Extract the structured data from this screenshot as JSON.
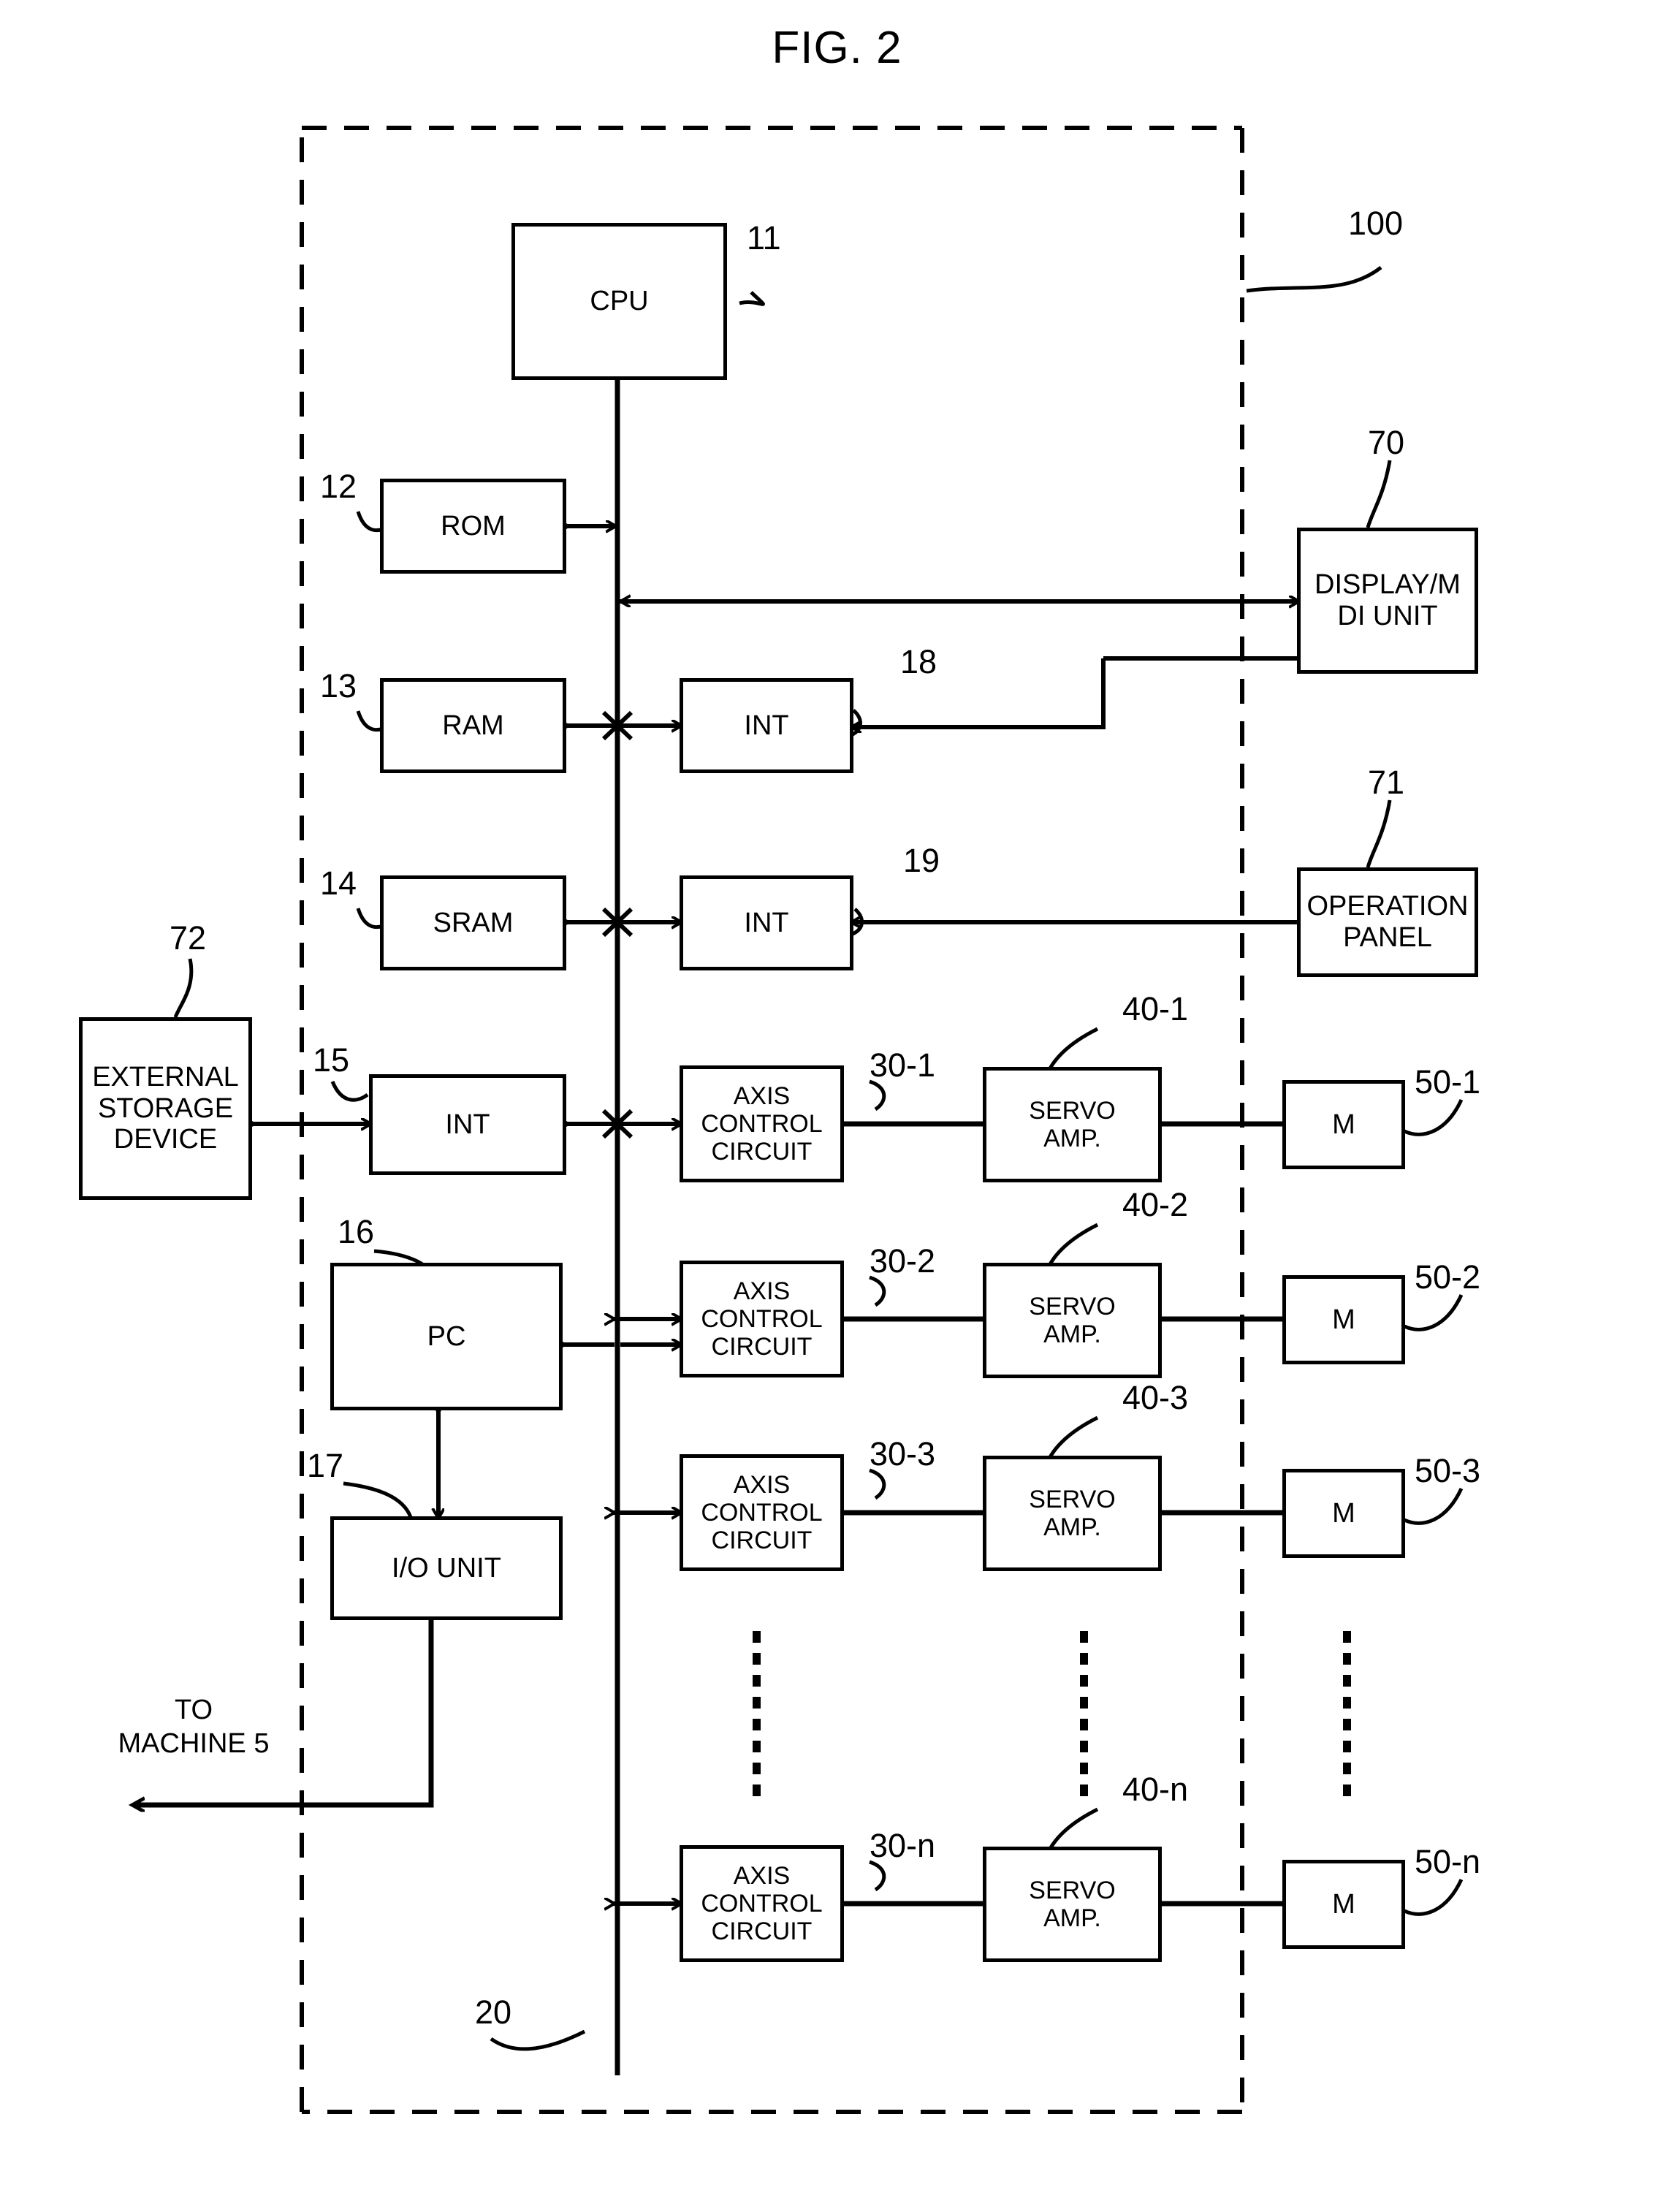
{
  "figure": {
    "title": "FIG. 2",
    "system_ref": "100",
    "bus_ref": "20"
  },
  "blocks": {
    "cpu": {
      "label": "CPU",
      "ref": "11"
    },
    "rom": {
      "label": "ROM",
      "ref": "12"
    },
    "ram": {
      "label": "RAM",
      "ref": "13"
    },
    "sram": {
      "label": "SRAM",
      "ref": "14"
    },
    "int15": {
      "label": "INT",
      "ref": "15"
    },
    "pc": {
      "label": "PC",
      "ref": "16"
    },
    "io": {
      "label": "I/O UNIT",
      "ref": "17"
    },
    "int18": {
      "label": "INT",
      "ref": "18"
    },
    "int19": {
      "label": "INT",
      "ref": "19"
    },
    "display": {
      "label": "DISPLAY/M\nDI UNIT",
      "ref": "70"
    },
    "operation": {
      "label": "OPERATION\nPANEL",
      "ref": "71"
    },
    "external": {
      "label": "EXTERNAL\nSTORAGE\nDEVICE",
      "ref": "72"
    }
  },
  "axes": [
    {
      "axis_label": "AXIS\nCONTROL\nCIRCUIT",
      "axis_ref": "30-1",
      "amp_label": "SERVO\nAMP.",
      "amp_ref": "40-1",
      "motor_label": "M",
      "motor_ref": "50-1"
    },
    {
      "axis_label": "AXIS\nCONTROL\nCIRCUIT",
      "axis_ref": "30-2",
      "amp_label": "SERVO\nAMP.",
      "amp_ref": "40-2",
      "motor_label": "M",
      "motor_ref": "50-2"
    },
    {
      "axis_label": "AXIS\nCONTROL\nCIRCUIT",
      "axis_ref": "30-3",
      "amp_label": "SERVO\nAMP.",
      "amp_ref": "40-3",
      "motor_label": "M",
      "motor_ref": "50-3"
    },
    {
      "axis_label": "AXIS\nCONTROL\nCIRCUIT",
      "axis_ref": "30-n",
      "amp_label": "SERVO\nAMP.",
      "amp_ref": "40-n",
      "motor_label": "M",
      "motor_ref": "50-n"
    }
  ],
  "annotations": {
    "to_machine": "TO\nMACHINE 5"
  },
  "colors": {
    "ink": "#000000",
    "paper": "#ffffff"
  }
}
